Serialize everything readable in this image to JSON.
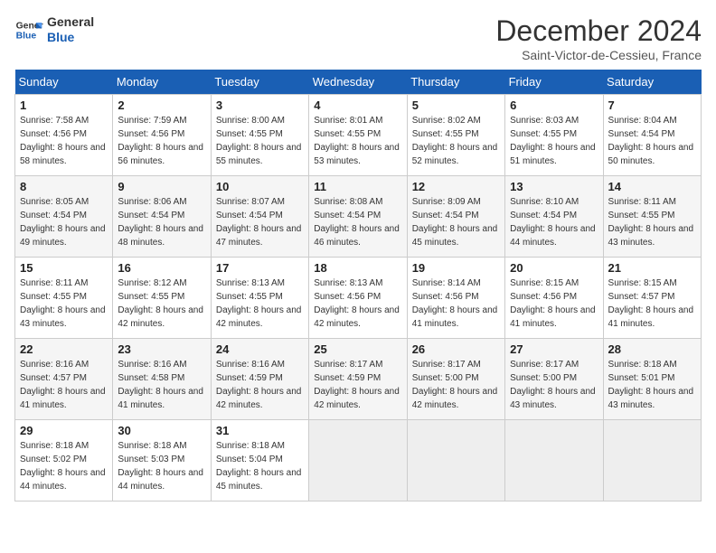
{
  "logo": {
    "line1": "General",
    "line2": "Blue"
  },
  "title": "December 2024",
  "location": "Saint-Victor-de-Cessieu, France",
  "header": {
    "days": [
      "Sunday",
      "Monday",
      "Tuesday",
      "Wednesday",
      "Thursday",
      "Friday",
      "Saturday"
    ]
  },
  "weeks": [
    [
      {
        "day": "1",
        "sunrise": "7:58 AM",
        "sunset": "4:56 PM",
        "daylight": "8 hours and 58 minutes."
      },
      {
        "day": "2",
        "sunrise": "7:59 AM",
        "sunset": "4:56 PM",
        "daylight": "8 hours and 56 minutes."
      },
      {
        "day": "3",
        "sunrise": "8:00 AM",
        "sunset": "4:55 PM",
        "daylight": "8 hours and 55 minutes."
      },
      {
        "day": "4",
        "sunrise": "8:01 AM",
        "sunset": "4:55 PM",
        "daylight": "8 hours and 53 minutes."
      },
      {
        "day": "5",
        "sunrise": "8:02 AM",
        "sunset": "4:55 PM",
        "daylight": "8 hours and 52 minutes."
      },
      {
        "day": "6",
        "sunrise": "8:03 AM",
        "sunset": "4:55 PM",
        "daylight": "8 hours and 51 minutes."
      },
      {
        "day": "7",
        "sunrise": "8:04 AM",
        "sunset": "4:54 PM",
        "daylight": "8 hours and 50 minutes."
      }
    ],
    [
      {
        "day": "8",
        "sunrise": "8:05 AM",
        "sunset": "4:54 PM",
        "daylight": "8 hours and 49 minutes."
      },
      {
        "day": "9",
        "sunrise": "8:06 AM",
        "sunset": "4:54 PM",
        "daylight": "8 hours and 48 minutes."
      },
      {
        "day": "10",
        "sunrise": "8:07 AM",
        "sunset": "4:54 PM",
        "daylight": "8 hours and 47 minutes."
      },
      {
        "day": "11",
        "sunrise": "8:08 AM",
        "sunset": "4:54 PM",
        "daylight": "8 hours and 46 minutes."
      },
      {
        "day": "12",
        "sunrise": "8:09 AM",
        "sunset": "4:54 PM",
        "daylight": "8 hours and 45 minutes."
      },
      {
        "day": "13",
        "sunrise": "8:10 AM",
        "sunset": "4:54 PM",
        "daylight": "8 hours and 44 minutes."
      },
      {
        "day": "14",
        "sunrise": "8:11 AM",
        "sunset": "4:55 PM",
        "daylight": "8 hours and 43 minutes."
      }
    ],
    [
      {
        "day": "15",
        "sunrise": "8:11 AM",
        "sunset": "4:55 PM",
        "daylight": "8 hours and 43 minutes."
      },
      {
        "day": "16",
        "sunrise": "8:12 AM",
        "sunset": "4:55 PM",
        "daylight": "8 hours and 42 minutes."
      },
      {
        "day": "17",
        "sunrise": "8:13 AM",
        "sunset": "4:55 PM",
        "daylight": "8 hours and 42 minutes."
      },
      {
        "day": "18",
        "sunrise": "8:13 AM",
        "sunset": "4:56 PM",
        "daylight": "8 hours and 42 minutes."
      },
      {
        "day": "19",
        "sunrise": "8:14 AM",
        "sunset": "4:56 PM",
        "daylight": "8 hours and 41 minutes."
      },
      {
        "day": "20",
        "sunrise": "8:15 AM",
        "sunset": "4:56 PM",
        "daylight": "8 hours and 41 minutes."
      },
      {
        "day": "21",
        "sunrise": "8:15 AM",
        "sunset": "4:57 PM",
        "daylight": "8 hours and 41 minutes."
      }
    ],
    [
      {
        "day": "22",
        "sunrise": "8:16 AM",
        "sunset": "4:57 PM",
        "daylight": "8 hours and 41 minutes."
      },
      {
        "day": "23",
        "sunrise": "8:16 AM",
        "sunset": "4:58 PM",
        "daylight": "8 hours and 41 minutes."
      },
      {
        "day": "24",
        "sunrise": "8:16 AM",
        "sunset": "4:59 PM",
        "daylight": "8 hours and 42 minutes."
      },
      {
        "day": "25",
        "sunrise": "8:17 AM",
        "sunset": "4:59 PM",
        "daylight": "8 hours and 42 minutes."
      },
      {
        "day": "26",
        "sunrise": "8:17 AM",
        "sunset": "5:00 PM",
        "daylight": "8 hours and 42 minutes."
      },
      {
        "day": "27",
        "sunrise": "8:17 AM",
        "sunset": "5:00 PM",
        "daylight": "8 hours and 43 minutes."
      },
      {
        "day": "28",
        "sunrise": "8:18 AM",
        "sunset": "5:01 PM",
        "daylight": "8 hours and 43 minutes."
      }
    ],
    [
      {
        "day": "29",
        "sunrise": "8:18 AM",
        "sunset": "5:02 PM",
        "daylight": "8 hours and 44 minutes."
      },
      {
        "day": "30",
        "sunrise": "8:18 AM",
        "sunset": "5:03 PM",
        "daylight": "8 hours and 44 minutes."
      },
      {
        "day": "31",
        "sunrise": "8:18 AM",
        "sunset": "5:04 PM",
        "daylight": "8 hours and 45 minutes."
      },
      null,
      null,
      null,
      null
    ]
  ]
}
